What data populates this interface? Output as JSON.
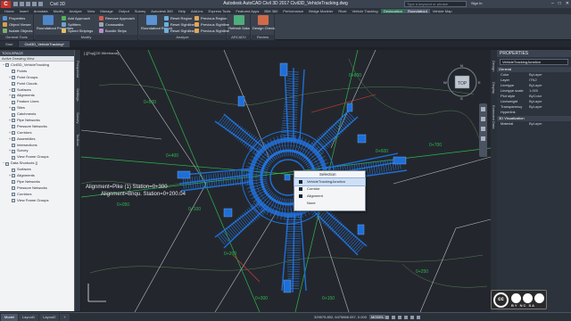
{
  "titlebar": {
    "app_letter": "C",
    "workspace": "Civil 3D",
    "title": "Autodesk AutoCAD Civil 3D 2017   Civil3D_VehicleTracking.dwg",
    "search_placeholder": "Type a keyword or phrase",
    "user": "Sign In",
    "min": "–",
    "max": "□",
    "close": "✕"
  },
  "ribbon_tabs": [
    "Home",
    "Insert",
    "Annotate",
    "Modify",
    "Analyze",
    "View",
    "Manage",
    "Output",
    "Survey",
    "Autodesk 360",
    "Help",
    "Add-ins",
    "Express Tools",
    "Featured Apps",
    "BIM 360",
    "Performance",
    "Bridge Modeler",
    "Rivet",
    "Vehicle Tracking",
    "Geolocation",
    "Roundabout",
    "Vehicle Map"
  ],
  "ribbon_tab_active": "Roundabout",
  "ribbon": {
    "general_tools": {
      "title": "General Tools",
      "items": [
        "Properties",
        "Object Viewer",
        "Isolate Objects"
      ]
    },
    "modify": {
      "title": "Modify",
      "items": [
        "Add Approach",
        "Splitters",
        "Speed Stripings",
        "Remove Approach",
        "Crosswalks",
        "Bundle Strips"
      ],
      "big": "Roundabout Properties"
    },
    "analyze": {
      "title": "Analyze",
      "big": "Roundabout Report",
      "items": [
        "Reset Region",
        "Reset Sightline",
        "Reset Sightline"
      ],
      "items2": [
        "Previous Region",
        "Previous Sightline",
        "Previous Sightline"
      ]
    },
    "arcadv": {
      "title": "ARCADV",
      "big": "Refresh Data"
    },
    "review": {
      "title": "Review",
      "big": "Design Check"
    }
  },
  "doc_tabs": [
    "Start",
    "Civil3D_VehicleTracking*"
  ],
  "doc_tab_active": 1,
  "toolspace": {
    "header": "TOOLSPACE",
    "view": "Active Drawing View",
    "tree": [
      {
        "label": "Civil3D_VehicleTracking",
        "level": 0,
        "exp": "−"
      },
      {
        "label": "Points",
        "level": 1,
        "exp": ""
      },
      {
        "label": "Point Groups",
        "level": 1,
        "exp": "+"
      },
      {
        "label": "Point Clouds",
        "level": 1,
        "exp": ""
      },
      {
        "label": "Surfaces",
        "level": 1,
        "exp": "+"
      },
      {
        "label": "Alignments",
        "level": 1,
        "exp": "+"
      },
      {
        "label": "Feature Lines",
        "level": 1,
        "exp": ""
      },
      {
        "label": "Sites",
        "level": 1,
        "exp": "+"
      },
      {
        "label": "Catchments",
        "level": 1,
        "exp": ""
      },
      {
        "label": "Pipe Networks",
        "level": 1,
        "exp": "+"
      },
      {
        "label": "Pressure Networks",
        "level": 1,
        "exp": ""
      },
      {
        "label": "Corridors",
        "level": 1,
        "exp": "+"
      },
      {
        "label": "Assemblies",
        "level": 1,
        "exp": "+"
      },
      {
        "label": "Intersections",
        "level": 1,
        "exp": ""
      },
      {
        "label": "Survey",
        "level": 1,
        "exp": "+"
      },
      {
        "label": "View Frame Groups",
        "level": 1,
        "exp": ""
      },
      {
        "label": "Data Shortcuts []",
        "level": 0,
        "exp": "−"
      },
      {
        "label": "Surfaces",
        "level": 1,
        "exp": ""
      },
      {
        "label": "Alignments",
        "level": 1,
        "exp": "+"
      },
      {
        "label": "Pipe Networks",
        "level": 1,
        "exp": ""
      },
      {
        "label": "Pressure Networks",
        "level": 1,
        "exp": ""
      },
      {
        "label": "Corridors",
        "level": 1,
        "exp": ""
      },
      {
        "label": "View Frame Groups",
        "level": 1,
        "exp": ""
      }
    ],
    "sidebar_tabs": [
      "Prospector",
      "Settings",
      "Survey",
      "Toolbox"
    ]
  },
  "viewport": {
    "label": "[-][Top][2D Wireframe]",
    "alignment_text_1": "Alignment=Pike (1) Station=0+300",
    "alignment_text_2": "Alignment=Bnqu. Station=0+200.04",
    "stations": [
      "0+100",
      "0+200",
      "0+300",
      "0+400",
      "0+500",
      "0+600",
      "0+700",
      "0+800",
      "0+050",
      "0+150",
      "0+250"
    ],
    "viewcube": "TOP",
    "compass": [
      "N",
      "S",
      "E",
      "W"
    ]
  },
  "context_menu": {
    "title": "Selection",
    "items": [
      "VehicleTrackingJunction",
      "Corridor",
      "Alignment",
      "None"
    ],
    "highlighted": 0
  },
  "properties": {
    "header": "PROPERTIES",
    "selector": "VehicleTrackingJunction",
    "sections": [
      {
        "title": "General",
        "rows": [
          [
            "Color",
            "ByLayer"
          ],
          [
            "Layer",
            "ITN2"
          ],
          [
            "Linetype",
            "ByLayer"
          ],
          [
            "Linetype scale",
            "1.000"
          ],
          [
            "Plot style",
            "ByColor"
          ],
          [
            "Lineweight",
            "ByLayer"
          ],
          [
            "Transparency",
            "ByLayer"
          ],
          [
            "Hyperlink",
            ""
          ]
        ]
      },
      {
        "title": "3D Visualization",
        "rows": [
          [
            "Material",
            "ByLayer"
          ]
        ]
      }
    ],
    "sidebar_tabs": [
      "Design",
      "Display",
      "Extended Data"
    ]
  },
  "statusbar": {
    "layout_tabs": [
      "Model",
      "Layout1",
      "Layout2",
      "+"
    ],
    "active_layout": 0,
    "coords": "329575.852, 6475866.057, 0.000",
    "model": "MODEL"
  },
  "cc_badge": {
    "cc": "cc",
    "label": "BY  NC  SA"
  },
  "colors": {
    "accent": "#1e6fd9",
    "alignment": "#d9d9d9",
    "station": "#27b04a",
    "contour": "#7fbf6a"
  }
}
